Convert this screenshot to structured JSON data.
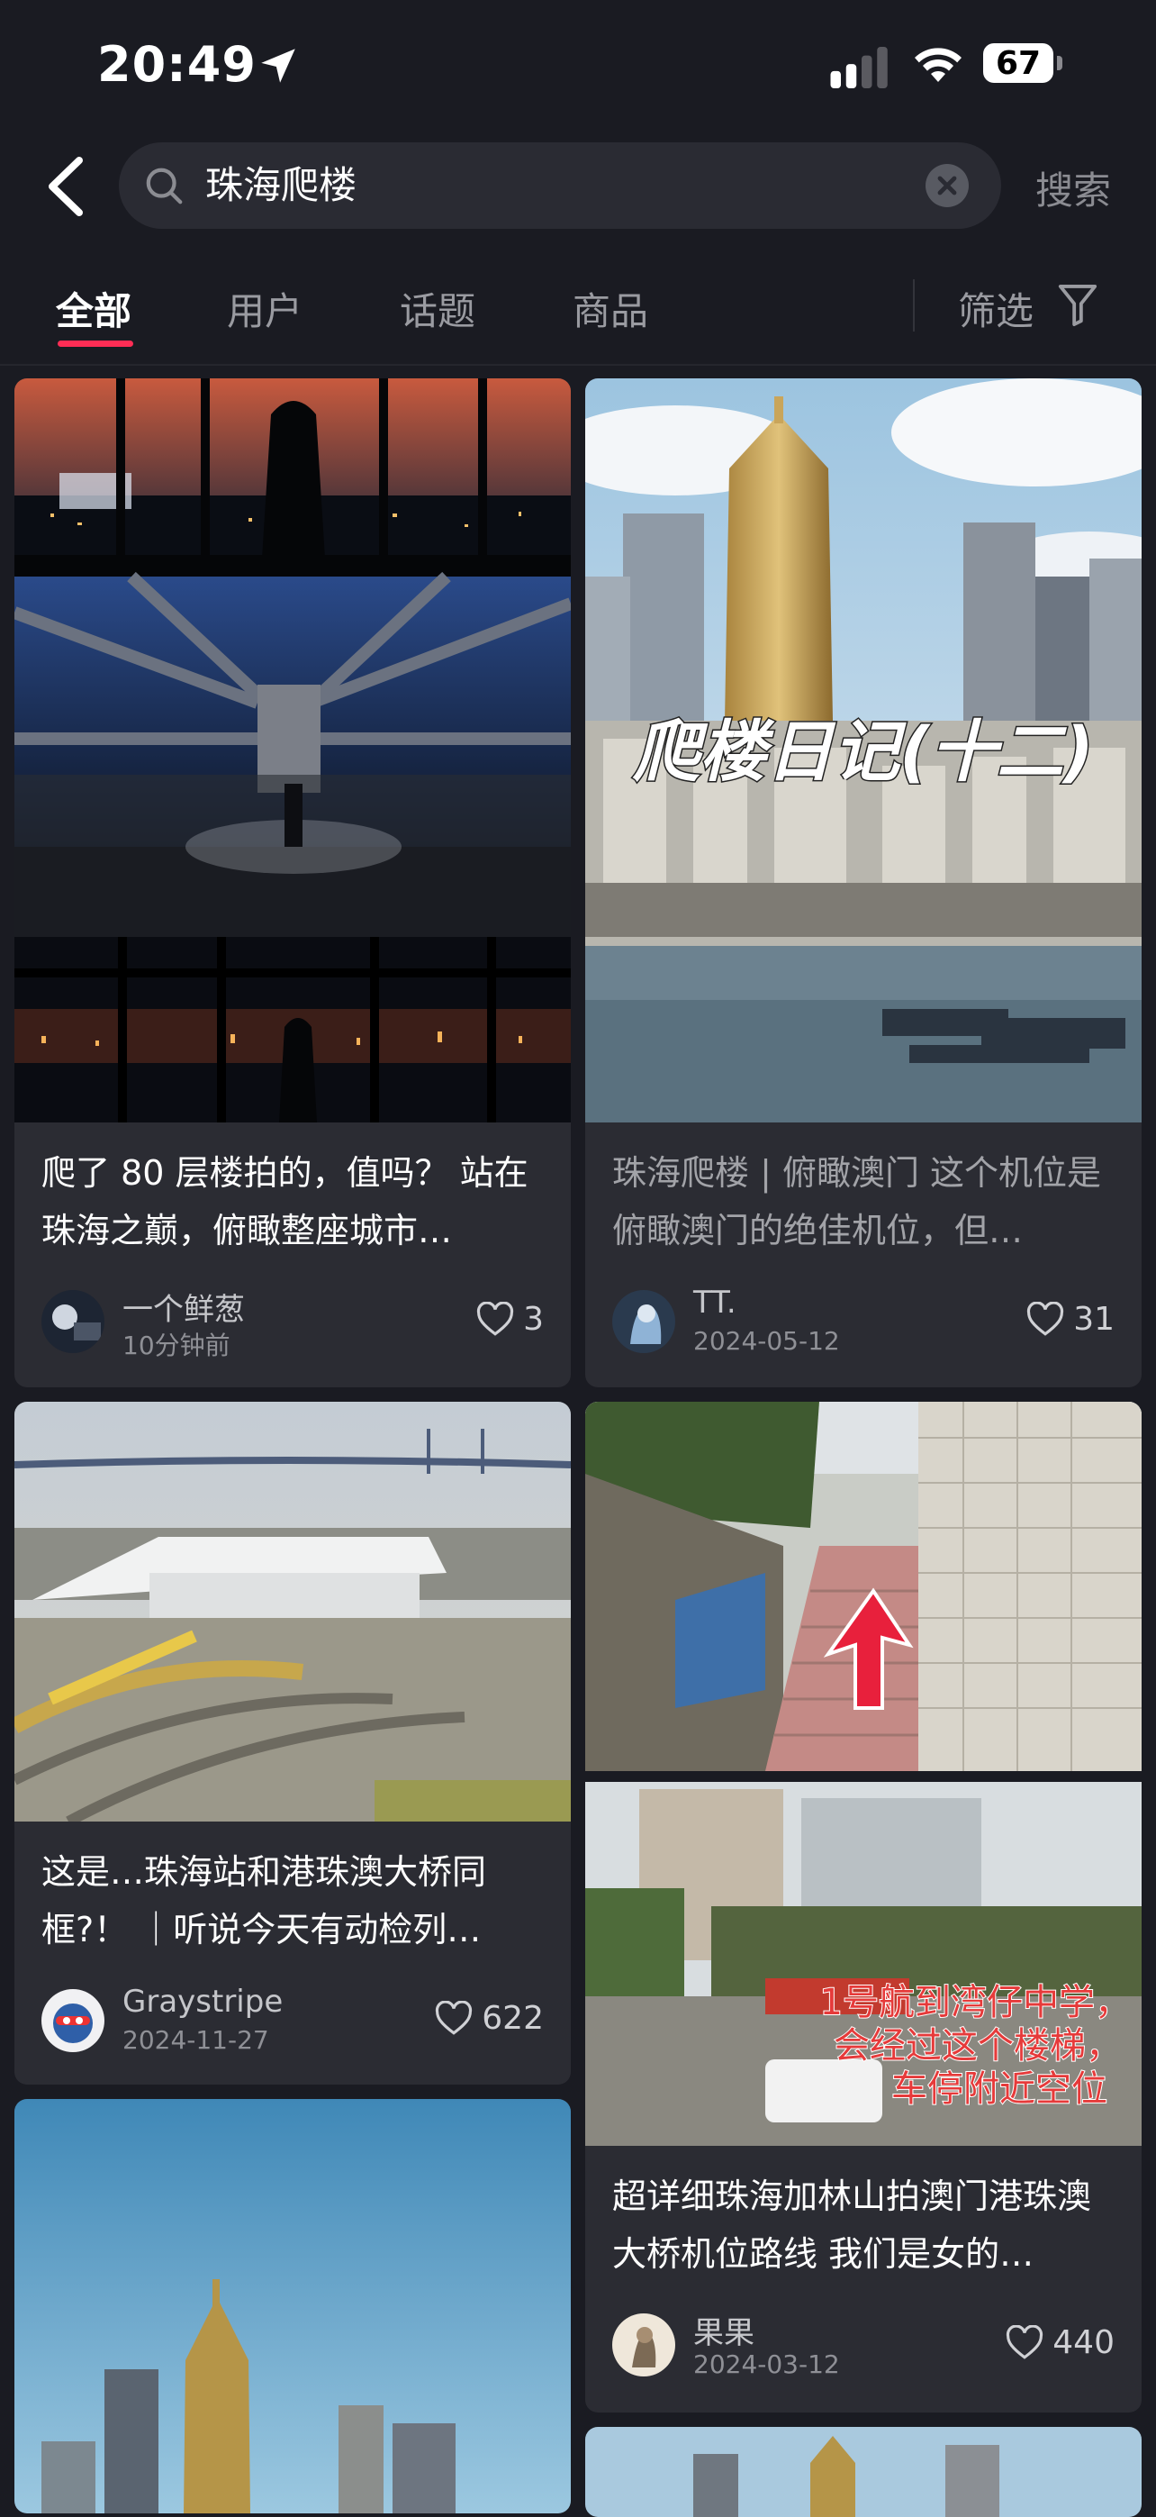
{
  "status": {
    "time": "20:49",
    "battery": "67"
  },
  "search": {
    "query": "珠海爬楼",
    "button": "搜索"
  },
  "tabs": [
    "全部",
    "用户",
    "话题",
    "商品"
  ],
  "filter_label": "筛选",
  "cards": [
    {
      "title": "爬了 80 层楼拍的，值吗？ 站在珠海之巅，俯瞰整座城市…",
      "author": "一个鲜葱",
      "date": "10分钟前",
      "likes": "3"
    },
    {
      "title": "珠海爬楼 | 俯瞰澳门 这个机位是俯瞰澳门的绝佳机位，但…",
      "author": "TT.",
      "date": "2024-05-12",
      "likes": "31",
      "image_text": "爬楼日记(十二)"
    },
    {
      "title": "这是…珠海站和港珠澳大桥同框?！ ｜听说今天有动检列…",
      "author": "Graystripe",
      "date": "2024-11-27",
      "likes": "622"
    },
    {
      "title": "超详细珠海加林山拍澳门港珠澳大桥机位路线 我们是女的…",
      "author": "果果",
      "date": "2024-03-12",
      "likes": "440",
      "image_text": [
        "1号航到湾仔中学，",
        "会经过这个楼梯，",
        "车停附近空位"
      ]
    }
  ],
  "colors": {
    "accent": "#ff2d55",
    "background": "#1a1b22",
    "card": "#2b2c33"
  }
}
